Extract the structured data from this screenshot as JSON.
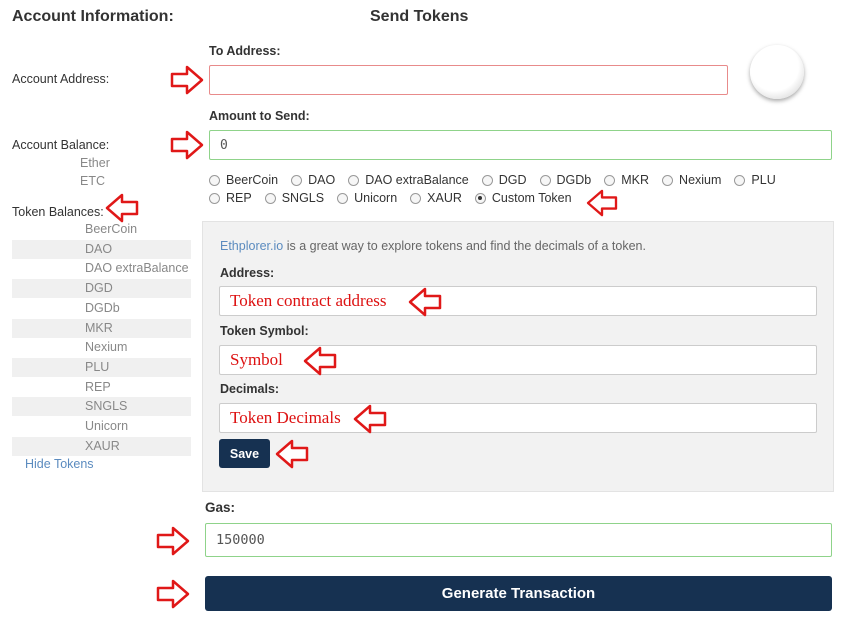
{
  "account": {
    "heading": "Account Information:",
    "address_label": "Account Address:",
    "balance_label": "Account Balance:",
    "balances": [
      "Ether",
      "ETC"
    ],
    "token_balances_label": "Token Balances:",
    "tokens": [
      "BeerCoin",
      "DAO",
      "DAO extraBalance",
      "DGD",
      "DGDb",
      "MKR",
      "Nexium",
      "PLU",
      "REP",
      "SNGLS",
      "Unicorn",
      "XAUR"
    ],
    "hide_tokens": "Hide Tokens"
  },
  "send": {
    "heading": "Send Tokens",
    "to_address_label": "To Address:",
    "to_address_value": "",
    "amount_label": "Amount to Send:",
    "amount_value": "0",
    "token_options_row1": [
      "BeerCoin",
      "DAO",
      "DAO extraBalance",
      "DGD",
      "DGDb",
      "MKR",
      "Nexium",
      "PLU"
    ],
    "token_options_row2": [
      "REP",
      "SNGLS",
      "Unicorn",
      "XAUR",
      "Custom Token"
    ],
    "selected_option": "Custom Token",
    "gas_label": "Gas:",
    "gas_value": "150000",
    "generate_button": "Generate Transaction"
  },
  "custom_token": {
    "note_link": "Ethplorer.io",
    "note_text": " is a great way to explore tokens and find the decimals of a token.",
    "address_label": "Address:",
    "address_placeholder": "Token contract address",
    "symbol_label": "Token Symbol:",
    "symbol_placeholder": "Symbol",
    "decimals_label": "Decimals:",
    "decimals_placeholder": "Token Decimals",
    "save_button": "Save"
  },
  "colors": {
    "accent": "#163151",
    "valid_border": "#8fd38a",
    "invalid_border": "#e88b8b",
    "arrow": "#e01818",
    "link": "#5b8bbf"
  }
}
